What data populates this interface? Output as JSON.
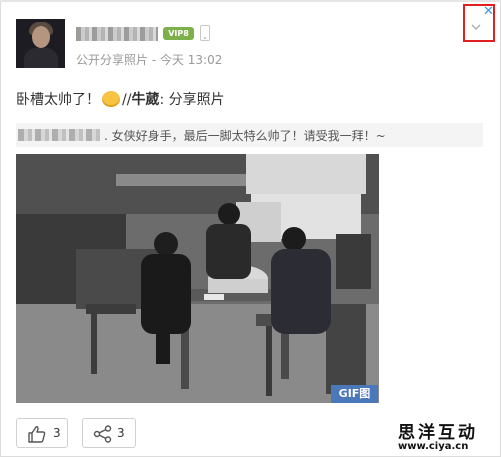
{
  "post": {
    "meta": "公开分享照片 - 今天 13:02",
    "vip_badge": "VIP8",
    "text_main": "卧槽太帅了！",
    "text_prefix": "//",
    "author": "牛葳",
    "text_suffix": ": 分享照片"
  },
  "quote": {
    "text": ". 女侠好身手，最后一脚太特么帅了！请受我一拜！~"
  },
  "media": {
    "badge": "GIF图"
  },
  "actions": {
    "like_count": "3",
    "share_count": "3"
  },
  "watermark": {
    "name": "思洋互动",
    "url": "www.ciya.cn"
  },
  "colors": {
    "accent": "#3a9ae0",
    "close_highlight": "#e02020",
    "vip": "#7db04a",
    "gif_badge": "#4a78b8"
  }
}
